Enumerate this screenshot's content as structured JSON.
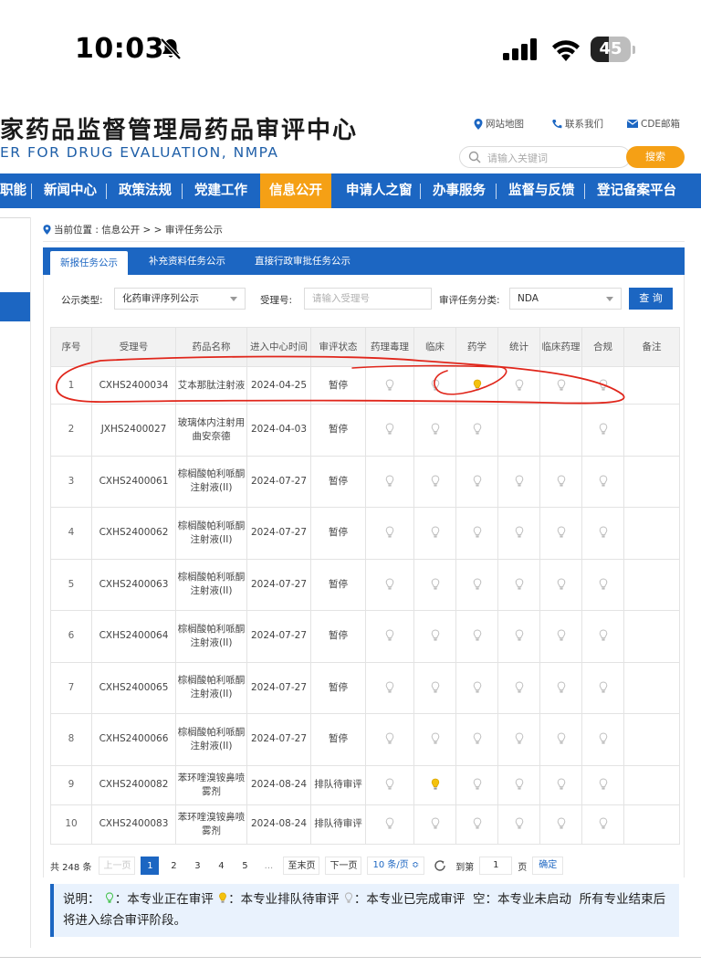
{
  "status_bar": {
    "time": "10:03",
    "battery": "45",
    "battery_level": 0.45
  },
  "site": {
    "title": "家药品监督管理局药品审评中心",
    "subtitle": "ER FOR DRUG EVALUATION, NMPA",
    "links": [
      "网站地图",
      "联系我们",
      "CDE邮箱"
    ],
    "search_placeholder": "请输入关键词",
    "search_button": "搜索"
  },
  "nav": {
    "items": [
      "职能",
      "新闻中心",
      "政策法规",
      "党建工作",
      "信息公开",
      "申请人之窗",
      "办事服务",
      "监督与反馈",
      "登记备案平台"
    ],
    "active_index": 4
  },
  "breadcrumb": {
    "prefix": "当前位置 : 信息公开 > > 审评任务公示"
  },
  "tabs": [
    "新报任务公示",
    "补充资料任务公示",
    "直接行政审批任务公示"
  ],
  "filters": {
    "type_label": "公示类型:",
    "type_value": "化药审评序列公示",
    "accept_label": "受理号:",
    "accept_placeholder": "请输入受理号",
    "category_label": "审评任务分类:",
    "category_value": "NDA",
    "query_button": "查 询"
  },
  "table": {
    "headers": [
      "序号",
      "受理号",
      "药品名称",
      "进入中心时间",
      "审评状态",
      "药理毒理",
      "临床",
      "药学",
      "统计",
      "临床药理",
      "合规",
      "备注"
    ],
    "rows": [
      {
        "no": "1",
        "accept_no": "CXHS2400034",
        "name": "艾本那肽注射液",
        "date": "2024-04-25",
        "status": "暂停",
        "bulbs": [
          "done",
          "done",
          "queue",
          "done",
          "done",
          "done"
        ],
        "note": ""
      },
      {
        "no": "2",
        "accept_no": "JXHS2400027",
        "name": "玻璃体内注射用曲安奈德",
        "date": "2024-04-03",
        "status": "暂停",
        "bulbs": [
          "done",
          "done",
          "done",
          "",
          "",
          "done"
        ],
        "note": ""
      },
      {
        "no": "3",
        "accept_no": "CXHS2400061",
        "name": "棕榈酸帕利哌酮注射液(II)",
        "date": "2024-07-27",
        "status": "暂停",
        "bulbs": [
          "done",
          "done",
          "done",
          "done",
          "done",
          "done"
        ],
        "note": ""
      },
      {
        "no": "4",
        "accept_no": "CXHS2400062",
        "name": "棕榈酸帕利哌酮注射液(II)",
        "date": "2024-07-27",
        "status": "暂停",
        "bulbs": [
          "done",
          "done",
          "done",
          "done",
          "done",
          "done"
        ],
        "note": ""
      },
      {
        "no": "5",
        "accept_no": "CXHS2400063",
        "name": "棕榈酸帕利哌酮注射液(II)",
        "date": "2024-07-27",
        "status": "暂停",
        "bulbs": [
          "done",
          "done",
          "done",
          "done",
          "done",
          "done"
        ],
        "note": ""
      },
      {
        "no": "6",
        "accept_no": "CXHS2400064",
        "name": "棕榈酸帕利哌酮注射液(II)",
        "date": "2024-07-27",
        "status": "暂停",
        "bulbs": [
          "done",
          "done",
          "done",
          "done",
          "done",
          "done"
        ],
        "note": ""
      },
      {
        "no": "7",
        "accept_no": "CXHS2400065",
        "name": "棕榈酸帕利哌酮注射液(II)",
        "date": "2024-07-27",
        "status": "暂停",
        "bulbs": [
          "done",
          "done",
          "done",
          "done",
          "done",
          "done"
        ],
        "note": ""
      },
      {
        "no": "8",
        "accept_no": "CXHS2400066",
        "name": "棕榈酸帕利哌酮注射液(II)",
        "date": "2024-07-27",
        "status": "暂停",
        "bulbs": [
          "done",
          "done",
          "done",
          "done",
          "done",
          "done"
        ],
        "note": ""
      },
      {
        "no": "9",
        "accept_no": "CXHS2400082",
        "name": "苯环喹溴铵鼻喷雾剂",
        "date": "2024-08-24",
        "status": "排队待审评",
        "bulbs": [
          "done",
          "queue",
          "done",
          "done",
          "done",
          "done"
        ],
        "note": ""
      },
      {
        "no": "10",
        "accept_no": "CXHS2400083",
        "name": "苯环喹溴铵鼻喷雾剂",
        "date": "2024-08-24",
        "status": "排队待审评",
        "bulbs": [
          "done",
          "done",
          "done",
          "done",
          "done",
          "done"
        ],
        "note": ""
      }
    ]
  },
  "pagination": {
    "total": "共 248 条",
    "prev": "上一页",
    "pages": [
      "1",
      "2",
      "3",
      "4",
      "5"
    ],
    "current": "1",
    "ellipsis": "...",
    "last": "至末页",
    "next": "下一页",
    "page_size": "10 条/页 ≎",
    "goto_label": "到第",
    "goto_value": "1",
    "page_unit": "页",
    "confirm": "确定"
  },
  "legend": {
    "prefix": "说明：",
    "active": "：本专业正在审评",
    "queue": "：本专业排队待审评",
    "done": "：本专业已完成审评",
    "empty": "空：本专业未启动",
    "tail": "所有专业结束后将进入综合审评阶段。"
  },
  "colors": {
    "primary": "#1c66c2",
    "accent": "#f5a015",
    "bulb_active": "#43c14a",
    "bulb_queue": "#f4c20d",
    "bulb_done": "#bdbdbd",
    "annotation": "#e0261b"
  }
}
